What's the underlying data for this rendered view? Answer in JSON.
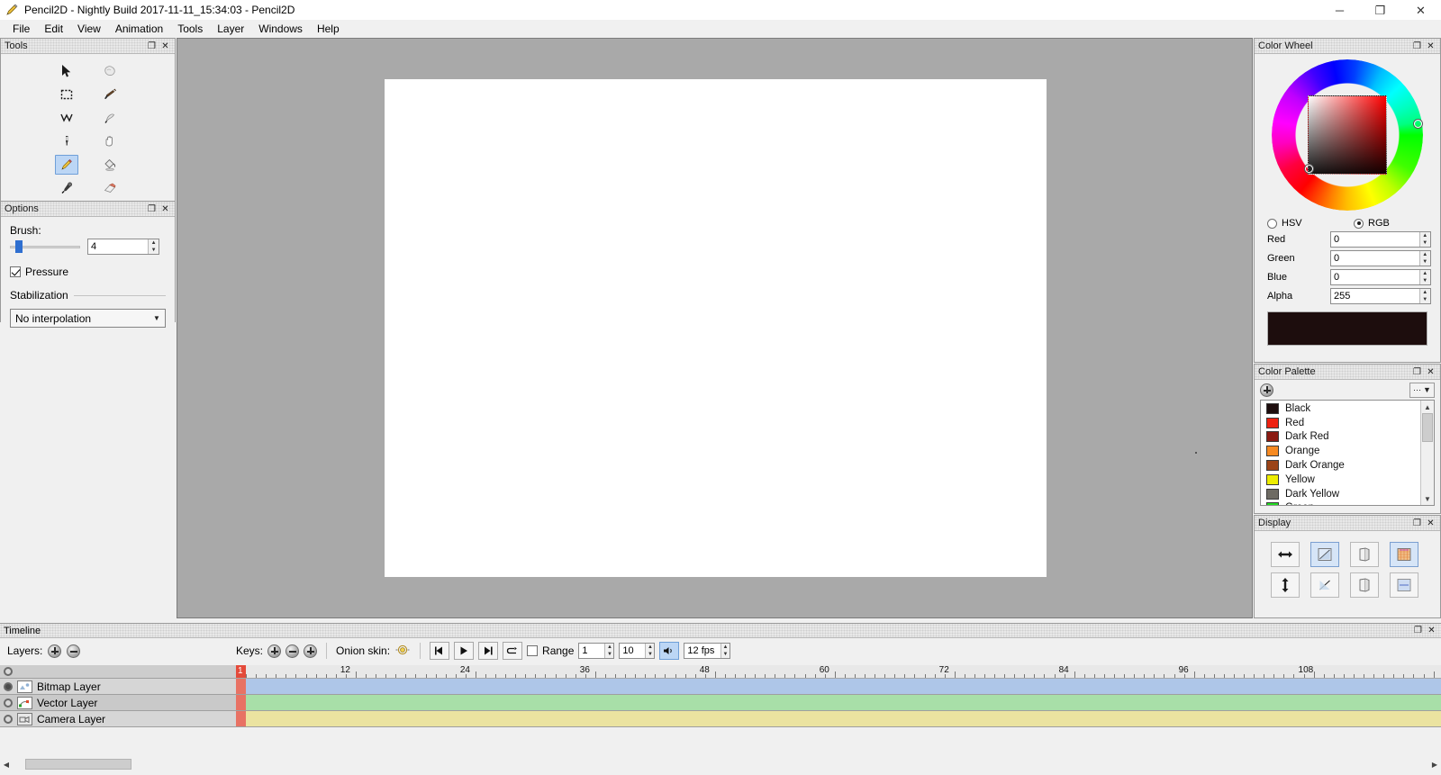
{
  "window": {
    "title": "Pencil2D - Nightly Build 2017-11-11_15:34:03 - Pencil2D",
    "app_icon": "pencil-icon",
    "minimize": "─",
    "maximize": "❐",
    "close": "✕"
  },
  "menubar": {
    "items": [
      {
        "label": "File"
      },
      {
        "label": "Edit"
      },
      {
        "label": "View"
      },
      {
        "label": "Animation"
      },
      {
        "label": "Tools"
      },
      {
        "label": "Layer"
      },
      {
        "label": "Windows"
      },
      {
        "label": "Help"
      }
    ]
  },
  "panel_buttons": {
    "float": "❐",
    "close": "✕"
  },
  "tools": {
    "title": "Tools",
    "items": [
      {
        "name": "move-tool",
        "icon": "cursor-arrow-icon",
        "selected": false
      },
      {
        "name": "smudge-tool",
        "icon": "smudge-icon",
        "selected": false
      },
      {
        "name": "select-tool",
        "icon": "dashed-rectangle-icon",
        "selected": false
      },
      {
        "name": "brush-tool",
        "icon": "paintbrush-icon",
        "selected": false
      },
      {
        "name": "polyline-tool",
        "icon": "polyline-icon",
        "selected": false
      },
      {
        "name": "pen-tool",
        "icon": "pen-stroke-icon",
        "selected": false
      },
      {
        "name": "ink-pen-tool",
        "icon": "fountain-pen-icon",
        "selected": false
      },
      {
        "name": "hand-tool",
        "icon": "hand-icon",
        "selected": false
      },
      {
        "name": "pencil-tool",
        "icon": "pencil-icon",
        "selected": true
      },
      {
        "name": "bucket-tool",
        "icon": "paint-bucket-icon",
        "selected": false
      },
      {
        "name": "eyedropper-tool",
        "icon": "eyedropper-icon",
        "selected": false
      },
      {
        "name": "eraser-tool",
        "icon": "eraser-icon",
        "selected": false
      }
    ]
  },
  "options": {
    "title": "Options",
    "brush_label": "Brush:",
    "brush_value": "4",
    "pressure_label": "Pressure",
    "pressure_checked": true,
    "stabilization_label": "Stabilization",
    "interpolation_value": "No interpolation"
  },
  "color_wheel": {
    "title": "Color Wheel",
    "mode_hsv": "HSV",
    "mode_rgb": "RGB",
    "selected_mode": "RGB",
    "channels": [
      {
        "label": "Red",
        "value": "0"
      },
      {
        "label": "Green",
        "value": "0"
      },
      {
        "label": "Blue",
        "value": "0"
      },
      {
        "label": "Alpha",
        "value": "255"
      }
    ],
    "preview_color": "#1d0d0d"
  },
  "color_palette": {
    "title": "Color Palette",
    "add_label": "+",
    "options_label": "⋯",
    "colors": [
      {
        "name": "Black",
        "hex": "#1d0d0d"
      },
      {
        "name": "Red",
        "hex": "#ee2211"
      },
      {
        "name": "Dark Red",
        "hex": "#8b1b12"
      },
      {
        "name": "Orange",
        "hex": "#f78a22"
      },
      {
        "name": "Dark Orange",
        "hex": "#9b4418"
      },
      {
        "name": "Yellow",
        "hex": "#eded00"
      },
      {
        "name": "Dark Yellow",
        "hex": "#6e6b63"
      },
      {
        "name": "Green",
        "hex": "#22dd22"
      }
    ]
  },
  "display": {
    "title": "Display",
    "buttons": [
      {
        "name": "flip-horizontal-button",
        "icon": "horizontal-arrow-icon",
        "selected": false
      },
      {
        "name": "onion-prev-button",
        "icon": "diagonal-up-icon",
        "selected": true
      },
      {
        "name": "mirror-button",
        "icon": "book-fold-icon",
        "selected": false
      },
      {
        "name": "overlay-grid-button",
        "icon": "orange-grid-icon",
        "selected": true
      },
      {
        "name": "flip-vertical-button",
        "icon": "vertical-arrow-icon",
        "selected": false
      },
      {
        "name": "onion-next-button",
        "icon": "diagonal-down-icon",
        "selected": false
      },
      {
        "name": "mirror-v-button",
        "icon": "book-fold-icon",
        "selected": false
      },
      {
        "name": "overlay-blue-button",
        "icon": "blue-grid-icon",
        "selected": false
      }
    ]
  },
  "timeline": {
    "title": "Timeline",
    "layers_label": "Layers:",
    "add_layer": "+",
    "remove_layer": "−",
    "keys_label": "Keys:",
    "onion_label": "Onion skin:",
    "range_label": "Range",
    "range_start": "1",
    "range_end": "10",
    "fps_value": "12 fps",
    "current_frame": "1",
    "ruler_labels": [
      "1",
      "12",
      "24",
      "36",
      "48",
      "60",
      "72",
      "84",
      "96",
      "108"
    ],
    "layers": [
      {
        "name": "Bitmap Layer",
        "icon": "bitmap-layer-icon",
        "visible": true,
        "track_color": "#aec6e8"
      },
      {
        "name": "Vector Layer",
        "icon": "vector-layer-icon",
        "visible": false,
        "track_color": "#a8dfa8"
      },
      {
        "name": "Camera Layer",
        "icon": "camera-layer-icon",
        "visible": false,
        "track_color": "#ebe3a0"
      }
    ]
  }
}
